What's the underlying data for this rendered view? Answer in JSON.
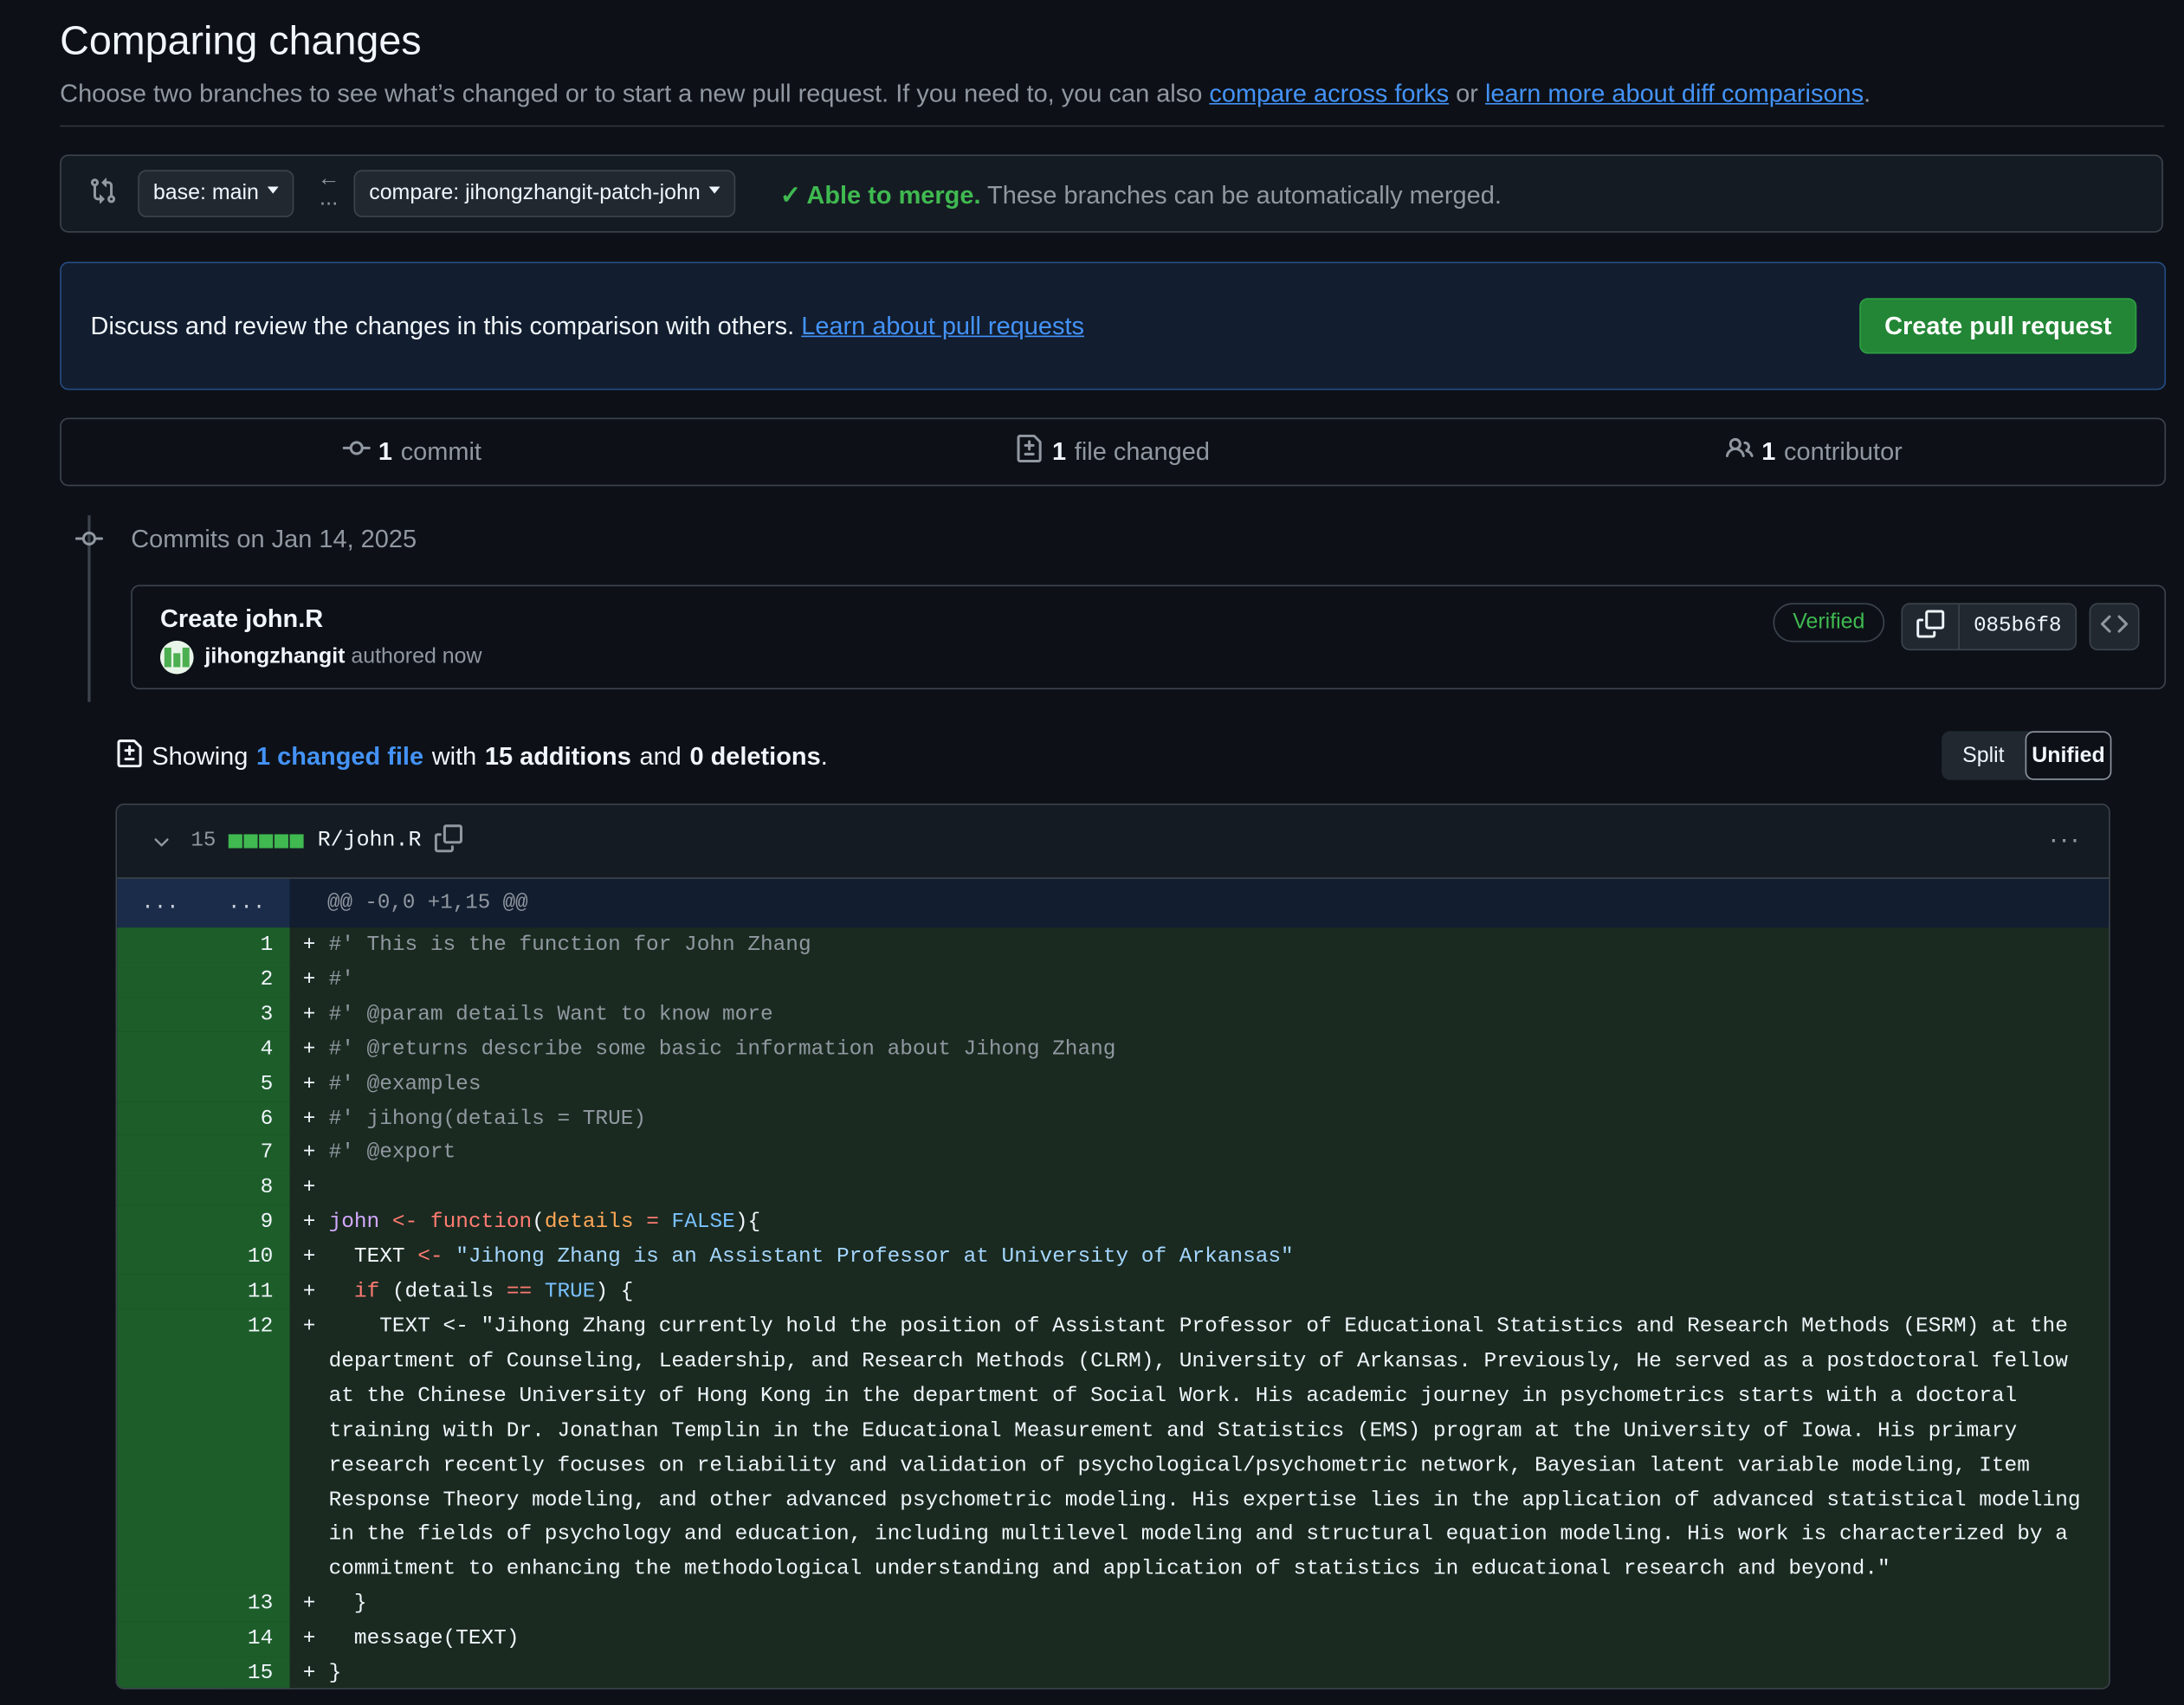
{
  "page": {
    "title": "Comparing changes",
    "subtitle_text": "Choose two branches to see what’s changed or to start a new pull request. If you need to, you can also ",
    "link_forks": "compare across forks",
    "subtitle_or": " or ",
    "link_learn_diff": "learn more about diff comparisons",
    "subtitle_end": "."
  },
  "range": {
    "base_label": "base: main",
    "compare_label": "compare: jihongzhangit-patch-john",
    "arrow": "←",
    "ellipsis": "...",
    "merge_ok": "Able to merge.",
    "merge_msg": " These branches can be automatically merged."
  },
  "flash": {
    "text": "Discuss and review the changes in this comparison with others. ",
    "link": "Learn about pull requests",
    "button": "Create pull request"
  },
  "summary": {
    "commits_count": "1",
    "commits_label": "commit",
    "files_count": "1",
    "files_label": "file changed",
    "contributors_count": "1",
    "contributors_label": "contributor"
  },
  "commits": {
    "date_heading": "Commits on Jan 14, 2025",
    "title": "Create john.R",
    "author": "jihongzhangit",
    "authored": "authored now",
    "verified": "Verified",
    "sha": "085b6f8"
  },
  "diffstat": {
    "showing": "Showing",
    "changed_link": "1 changed file",
    "with": "with",
    "additions": "15 additions",
    "and": "and",
    "deletions": "0 deletions",
    "period": ".",
    "split": "Split",
    "unified": "Unified"
  },
  "file": {
    "count": "15",
    "name": "R/john.R",
    "more": "···",
    "hunk_left": "...",
    "hunk_right": "...",
    "hunk_header": "@@ -0,0 +1,15 @@"
  },
  "diff_lines": [
    {
      "num": "1",
      "segments": [
        {
          "t": "#' This is the function for John Zhang",
          "c": "com"
        }
      ]
    },
    {
      "num": "2",
      "segments": [
        {
          "t": "#'",
          "c": "com"
        }
      ]
    },
    {
      "num": "3",
      "segments": [
        {
          "t": "#' @param details Want to know more",
          "c": "com"
        }
      ]
    },
    {
      "num": "4",
      "segments": [
        {
          "t": "#' @returns describe some basic information about Jihong Zhang",
          "c": "com"
        }
      ]
    },
    {
      "num": "5",
      "segments": [
        {
          "t": "#' @examples",
          "c": "com"
        }
      ]
    },
    {
      "num": "6",
      "segments": [
        {
          "t": "#' jihong(details = TRUE)",
          "c": "com"
        }
      ]
    },
    {
      "num": "7",
      "segments": [
        {
          "t": "#' @export",
          "c": "com"
        }
      ]
    },
    {
      "num": "8",
      "segments": []
    },
    {
      "num": "9",
      "segments": [
        {
          "t": "john",
          "c": "var"
        },
        {
          "t": " ",
          "c": ""
        },
        {
          "t": "<-",
          "c": "kw"
        },
        {
          "t": " ",
          "c": ""
        },
        {
          "t": "function",
          "c": "kw"
        },
        {
          "t": "(",
          "c": ""
        },
        {
          "t": "details",
          "c": "arg"
        },
        {
          "t": " ",
          "c": ""
        },
        {
          "t": "=",
          "c": "kw"
        },
        {
          "t": " ",
          "c": ""
        },
        {
          "t": "FALSE",
          "c": "const"
        },
        {
          "t": "){",
          "c": ""
        }
      ]
    },
    {
      "num": "10",
      "segments": [
        {
          "t": "  TEXT ",
          "c": ""
        },
        {
          "t": "<-",
          "c": "kw"
        },
        {
          "t": " ",
          "c": ""
        },
        {
          "t": "\"Jihong Zhang is an Assistant Professor at University of Arkansas\"",
          "c": "str"
        }
      ]
    },
    {
      "num": "11",
      "segments": [
        {
          "t": "  ",
          "c": ""
        },
        {
          "t": "if",
          "c": "kw"
        },
        {
          "t": " (details ",
          "c": ""
        },
        {
          "t": "==",
          "c": "kw"
        },
        {
          "t": " ",
          "c": ""
        },
        {
          "t": "TRUE",
          "c": "const"
        },
        {
          "t": ") {",
          "c": ""
        }
      ]
    },
    {
      "num": "12",
      "segments": [
        {
          "t": "    TEXT <- \"Jihong Zhang currently hold the position of Assistant Professor of Educational Statistics and Research Methods (ESRM) at the department of Counseling, Leadership, and Research Methods (CLRM), University of Arkansas. Previously, He served as a postdoctoral fellow at the Chinese University of Hong Kong in the department of Social Work. His academic journey in psychometrics starts with a doctoral training with Dr. Jonathan Templin in the Educational Measurement and Statistics (EMS) program at the University of Iowa. His primary research recently focuses on reliability and validation of psychological/psychometric network, Bayesian latent variable modeling, Item Response Theory modeling, and other advanced psychometric modeling. His expertise lies in the application of advanced statistical modeling in the fields of psychology and education, including multilevel modeling and structural equation modeling. His work is characterized by a commitment to enhancing the methodological understanding and application of statistics in educational research and beyond.\"",
          "c": ""
        }
      ]
    },
    {
      "num": "13",
      "segments": [
        {
          "t": "  }",
          "c": ""
        }
      ]
    },
    {
      "num": "14",
      "segments": [
        {
          "t": "  message(TEXT)",
          "c": ""
        }
      ]
    },
    {
      "num": "15",
      "segments": [
        {
          "t": "}",
          "c": ""
        }
      ]
    }
  ],
  "colors": {
    "background": "#0d1117",
    "accent_link": "#4493f8",
    "success": "#3fb950",
    "button_green": "#238636",
    "addition_bg": "#1a2a20",
    "addition_num_bg": "#1d5d2a"
  },
  "icons": [
    "git-compare-icon",
    "check-icon",
    "git-commit-icon",
    "file-diff-icon",
    "people-icon",
    "copy-icon",
    "code-icon",
    "chevron-down-icon",
    "kebab-horizontal-icon"
  ]
}
